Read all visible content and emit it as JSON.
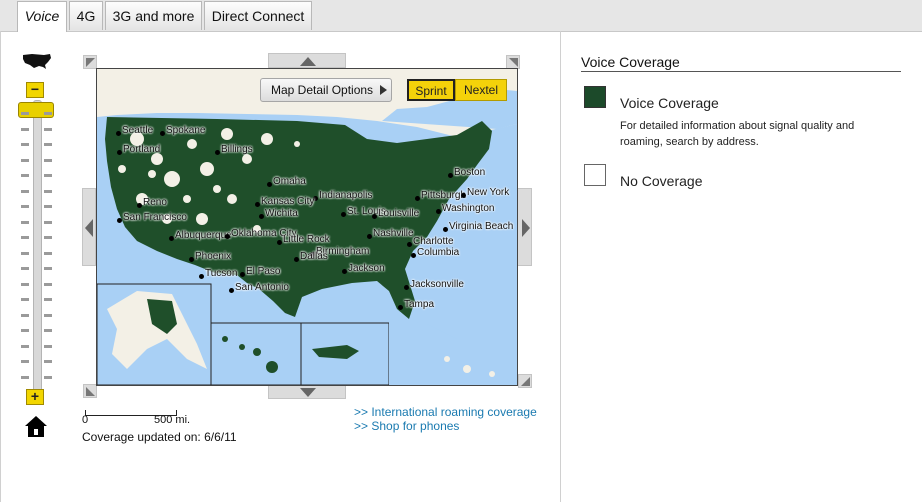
{
  "tabs": [
    {
      "label": "Voice",
      "active": true
    },
    {
      "label": "4G",
      "active": false
    },
    {
      "label": "3G and more",
      "active": false
    },
    {
      "label": "Direct Connect",
      "active": false
    }
  ],
  "map": {
    "detail_options_label": "Map Detail Options",
    "carriers": [
      {
        "label": "Sprint",
        "selected": true
      },
      {
        "label": "Nextel",
        "selected": false
      }
    ],
    "cities": [
      "Seattle",
      "Spokane",
      "Portland",
      "Billings",
      "Reno",
      "San Francisco",
      "Omaha",
      "Indianapolis",
      "Kansas City",
      "Wichita",
      "St. Louis",
      "Louisville",
      "Pittsburgh",
      "Boston",
      "New York",
      "Washington",
      "Virginia Beach",
      "Albuquerque",
      "Oklahoma City",
      "Little Rock",
      "Nashville",
      "Charlotte",
      "Columbia",
      "Birmingham",
      "Phoenix",
      "Tucson",
      "El Paso",
      "Dallas",
      "Jackson",
      "San Antonio",
      "Jacksonville",
      "Tampa"
    ],
    "scale_zero": "0",
    "scale_max": "500 mi.",
    "coverage_updated": "Coverage updated on: 6/6/11",
    "colors": {
      "coverage": "#1f4f2a",
      "water": "#a9d0f5",
      "land": "#f3f0e6"
    }
  },
  "links": {
    "roaming": ">> International roaming coverage",
    "phones": ">> Shop for phones"
  },
  "legend": {
    "title": "Voice Coverage",
    "items": [
      {
        "label": "Voice Coverage",
        "color": "#1c4a2a",
        "description": "For detailed information about signal quality and roaming, search by address."
      },
      {
        "label": "No Coverage",
        "color": "#ffffff"
      }
    ]
  }
}
